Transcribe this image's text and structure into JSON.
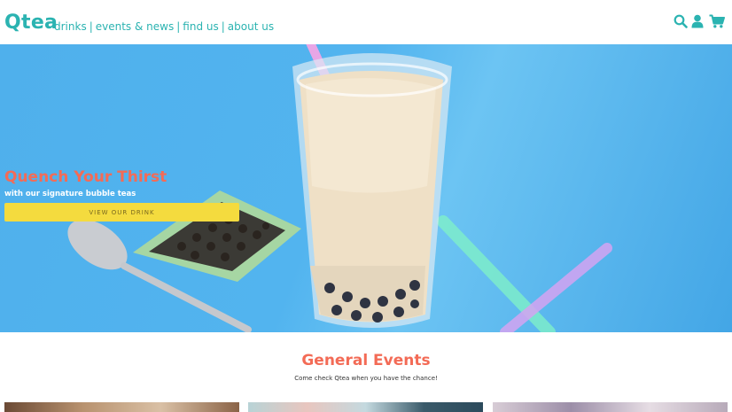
{
  "nav": {
    "logo": "Qtea",
    "links": [
      "drinks",
      "events & news",
      "find us",
      "about us"
    ],
    "separator": "|",
    "icons": [
      "search-icon",
      "user-icon",
      "cart-icon"
    ],
    "accent_color": "#2bb3b1"
  },
  "hero": {
    "title": "Quench Your Thirst",
    "subtitle": "with our signature bubble teas",
    "cta_label": "VIEW OUR DRINK",
    "title_color": "#f36b56",
    "cta_color": "#f4db3e"
  },
  "events": {
    "title": "General Events",
    "subtitle": "Come check Qtea when you have the chance!"
  }
}
